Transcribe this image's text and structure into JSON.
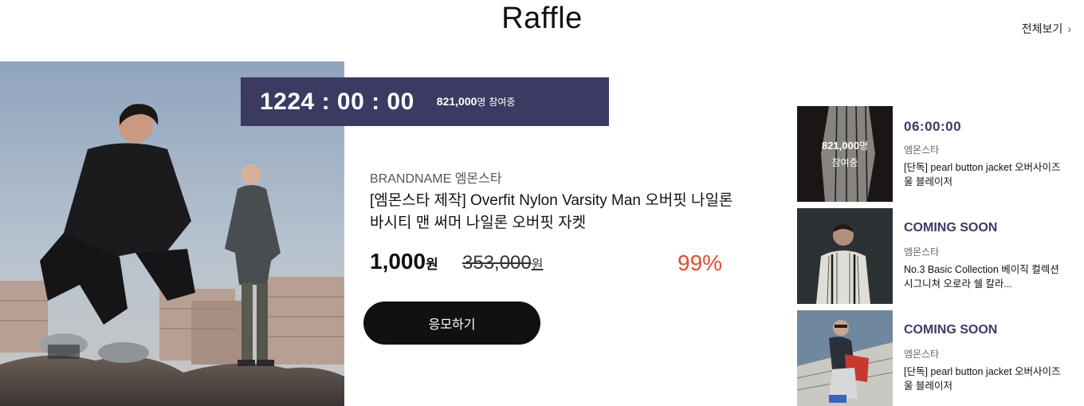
{
  "header": {
    "title": "Raffle",
    "view_all_label": "전체보기",
    "view_all_icon": "chevron-right-icon"
  },
  "main": {
    "countdown": "1224 : 00 : 00",
    "participants_count": "821,000",
    "participants_unit": "명",
    "participants_suffix": "참여중",
    "brand_prefix": "BRANDNAME",
    "brand_name": "엠몬스타",
    "product_name": "[엠몬스타 제작] Overfit Nylon Varsity Man 오버핏 나일론 바시티 맨 써머 나일론 오버핏 자켓",
    "price": "1,000",
    "price_unit": "원",
    "original_price": "353,000",
    "original_price_unit": "원",
    "discount": "99%",
    "apply_label": "응모하기"
  },
  "side_list": [
    {
      "status": "06:00:00",
      "brand": "엠몬스타",
      "name": "[단독] pearl button jacket 오버사이즈 울 블레이저",
      "overlay_count": "821,000",
      "overlay_unit": "명",
      "overlay_label": "참여중"
    },
    {
      "status": "COMING SOON",
      "brand": "엠몬스타",
      "name": "No.3 Basic Collection 베이직 컬렉션 시그니쳐 오로라 쉘 칼라..."
    },
    {
      "status": "COMING SOON",
      "brand": "엠몬스타",
      "name": "[단독] pearl button jacket 오버사이즈 울 블레이저"
    }
  ],
  "colors": {
    "accent_navy": "#3a3a63",
    "discount_red": "#e64a2e",
    "button_black": "#111111"
  }
}
